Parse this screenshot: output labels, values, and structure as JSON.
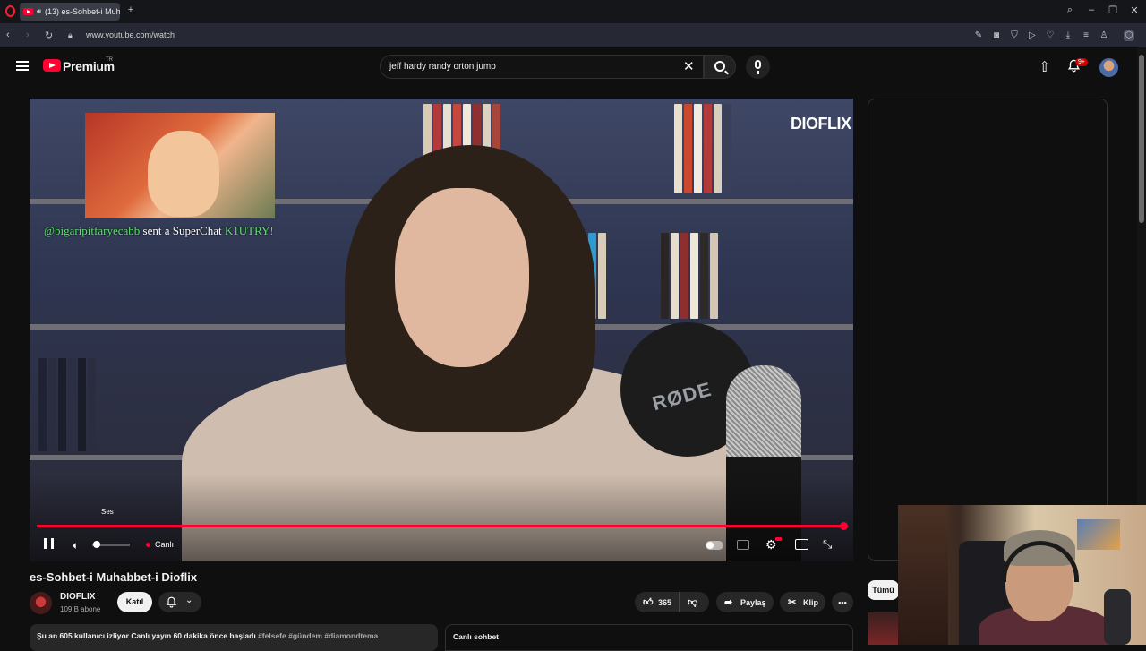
{
  "browser": {
    "tab_title": "(13) es-Sohbet-i Muh...",
    "url": "www.youtube.com/watch"
  },
  "header": {
    "brand": "Premium",
    "region": "TR",
    "search_value": "jeff hardy randy orton jump",
    "notifications_badge": "9+"
  },
  "player": {
    "overlay_logo": "DIOFLIX",
    "superchat_user": "@bigaripitfaryecabb",
    "superchat_text": " sent a SuperChat ",
    "superchat_amount": "K1UTRY!",
    "volume_tooltip": "Ses",
    "live_label": "Canlı",
    "progress": 1.0,
    "mic_brand": "RØDE"
  },
  "video": {
    "title": "es-Sohbet-i Muhabbet-i Dioflix",
    "channel_name": "DIOFLIX",
    "subscribers": "109 B abone",
    "join_label": "Katıl",
    "likes": "365",
    "share_label": "Paylaş",
    "clip_label": "Klip"
  },
  "description": {
    "stats": "Şu an 605 kullanıcı izliyor  Canlı yayın 60 dakika önce başladı",
    "tags": " #felsefe #gündem #diamondtema"
  },
  "chat": {
    "title": "Canlı sohbet"
  },
  "sidebar": {
    "all_chip": "Tümü"
  },
  "colors": {
    "accent": "#ff0033",
    "background": "#0f0f0f",
    "chip": "#272727"
  }
}
